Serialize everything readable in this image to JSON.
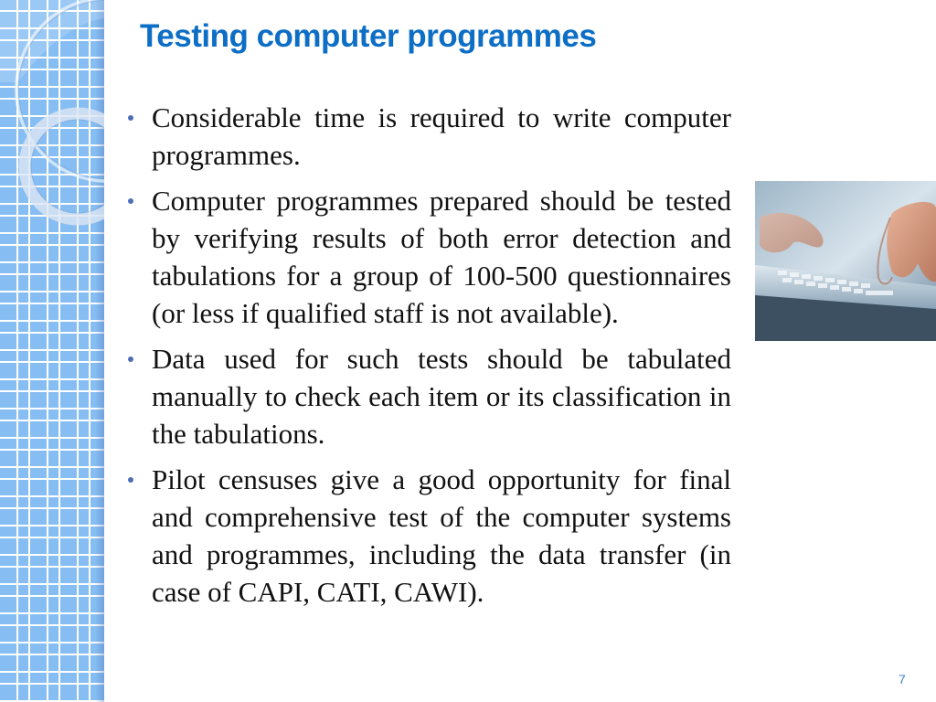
{
  "slide": {
    "title": "Testing computer programmes",
    "bullets": [
      {
        "text": "Considerable time is required to write computer programmes."
      },
      {
        "text": "Computer programmes prepared should be tested by verifying results of both error detection and tabulations for a group of 100-500 questionnaires (or less if qualified staff is not available)."
      },
      {
        "text": "Data used for such tests should be tabulated manually to check each item or its classification in the tabulations."
      },
      {
        "text": "Pilot censuses give a good opportunity for final and comprehensive test of the computer systems and programmes, including the data transfer (in case of CAPI, CATI, CAWI)."
      }
    ],
    "image": {
      "alt": "hands typing on a laptop keyboard",
      "icon": "laptop-typing-photo"
    },
    "page_number": "7"
  },
  "theme": {
    "title_color": "#0d6ec6",
    "bullet_color": "#4f6eb8",
    "strip_color": "#86bdf3",
    "page_number_color": "#3f7fd0"
  }
}
